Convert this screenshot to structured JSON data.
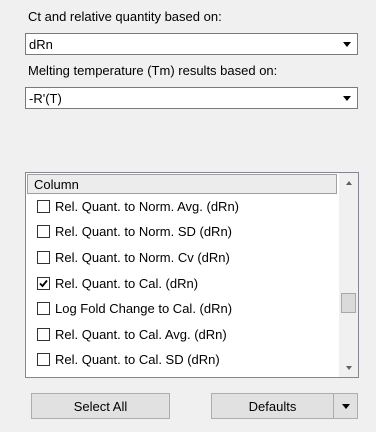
{
  "ct_quantity": {
    "label": "Ct and relative quantity based on:",
    "value": "dRn"
  },
  "melting": {
    "label": "Melting temperature (Tm) results based on:",
    "value": "-R'(T)"
  },
  "column_list": {
    "header": "Column",
    "rows": [
      {
        "label": "Rel. Quant. to Norm. Avg. (dRn)",
        "checked": false
      },
      {
        "label": "Rel. Quant. to Norm. SD (dRn)",
        "checked": false
      },
      {
        "label": "Rel. Quant. to Norm. Cv (dRn)",
        "checked": false
      },
      {
        "label": "Rel. Quant. to Cal. (dRn)",
        "checked": true
      },
      {
        "label": "Log Fold Change to Cal. (dRn)",
        "checked": false
      },
      {
        "label": "Rel. Quant. to Cal. Avg. (dRn)",
        "checked": false
      },
      {
        "label": "Rel. Quant. to Cal. SD (dRn)",
        "checked": false
      }
    ]
  },
  "buttons": {
    "select_all": "Select All",
    "defaults": "Defaults"
  },
  "icons": {
    "dropdown": "chevron-down-icon",
    "scroll_up": "scroll-up-icon",
    "scroll_down": "scroll-down-icon",
    "check": "checkmark-icon"
  }
}
